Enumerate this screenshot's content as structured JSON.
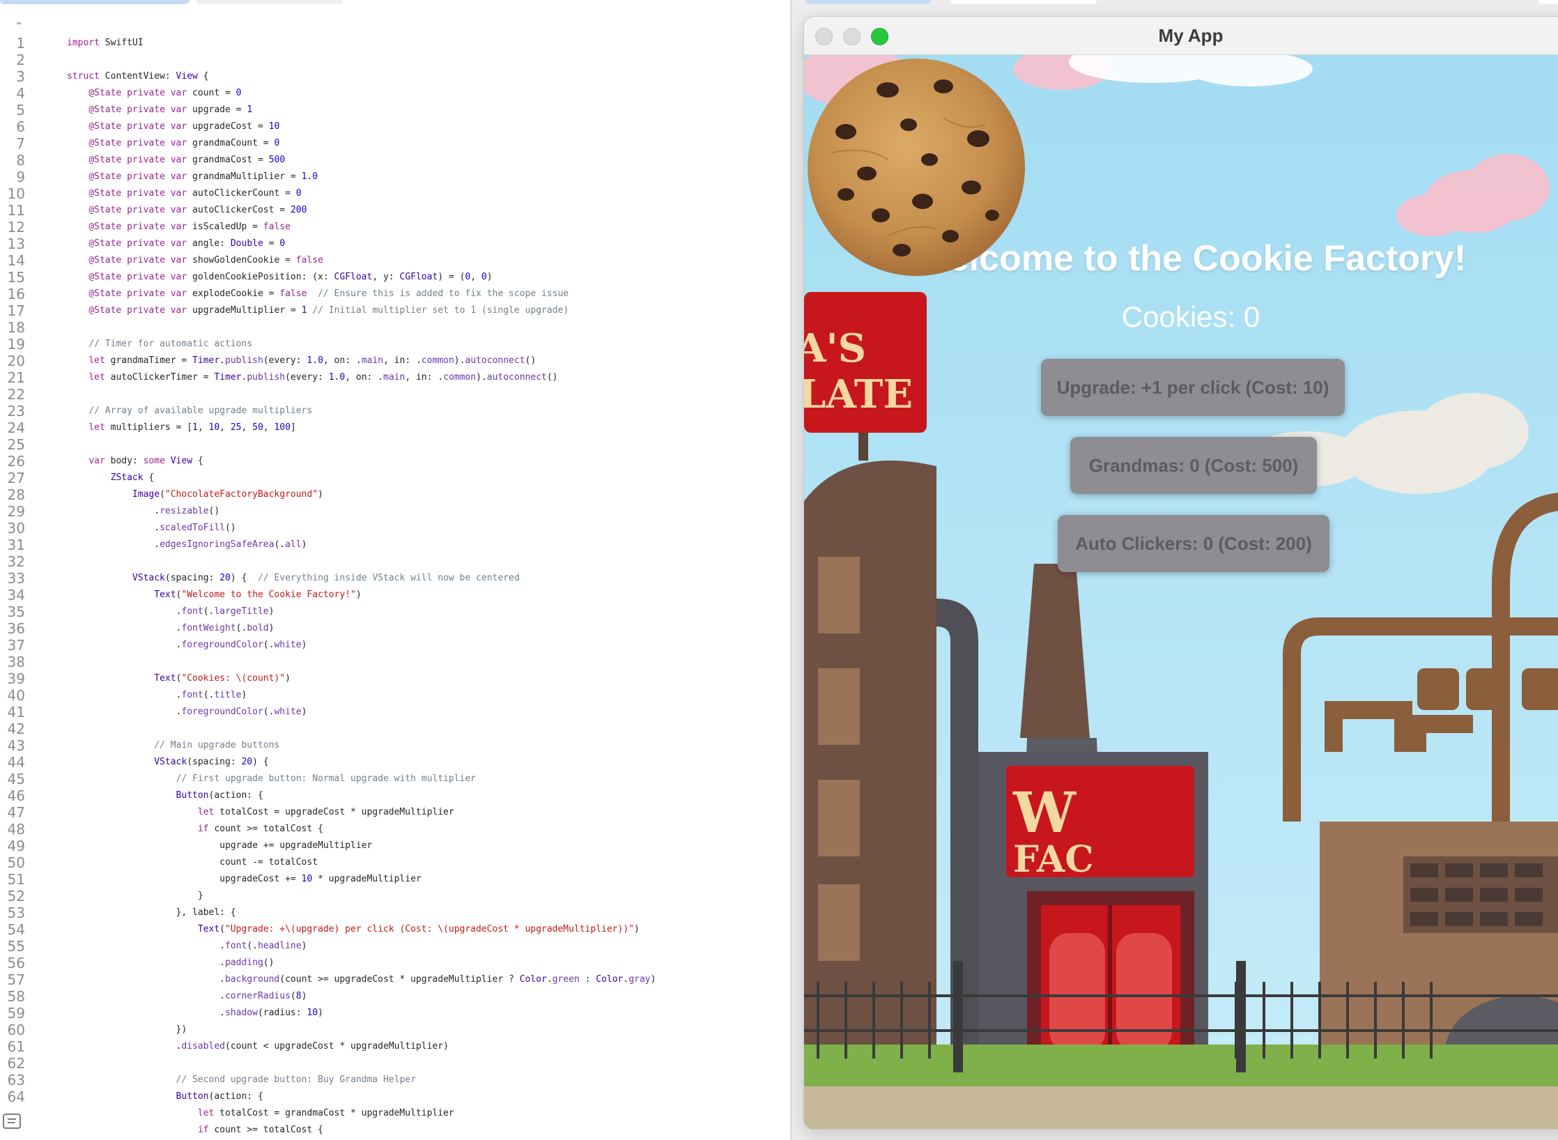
{
  "editor": {
    "lines": [
      {
        "n": "1",
        "t": "import SwiftUI"
      },
      {
        "n": "2",
        "t": ""
      },
      {
        "n": "3",
        "t": "struct ContentView: View {"
      },
      {
        "n": "4",
        "t": "    @State private var count = 0"
      },
      {
        "n": "5",
        "t": "    @State private var upgrade = 1"
      },
      {
        "n": "6",
        "t": "    @State private var upgradeCost = 10"
      },
      {
        "n": "7",
        "t": "    @State private var grandmaCount = 0"
      },
      {
        "n": "8",
        "t": "    @State private var grandmaCost = 500"
      },
      {
        "n": "9",
        "t": "    @State private var grandmaMultiplier = 1.0"
      },
      {
        "n": "10",
        "t": "    @State private var autoClickerCount = 0"
      },
      {
        "n": "11",
        "t": "    @State private var autoClickerCost = 200"
      },
      {
        "n": "12",
        "t": "    @State private var isScaledUp = false"
      },
      {
        "n": "13",
        "t": "    @State private var angle: Double = 0"
      },
      {
        "n": "14",
        "t": "    @State private var showGoldenCookie = false"
      },
      {
        "n": "15",
        "t": "    @State private var goldenCookiePosition: (x: CGFloat, y: CGFloat) = (0, 0)"
      },
      {
        "n": "16",
        "t": "    @State private var explodeCookie = false  // Ensure this is added to fix the scope issue"
      },
      {
        "n": "17",
        "t": "    @State private var upgradeMultiplier = 1 // Initial multiplier set to 1 (single upgrade)"
      },
      {
        "n": "18",
        "t": ""
      },
      {
        "n": "19",
        "t": "    // Timer for automatic actions"
      },
      {
        "n": "20",
        "t": "    let grandmaTimer = Timer.publish(every: 1.0, on: .main, in: .common).autoconnect()"
      },
      {
        "n": "21",
        "t": "    let autoClickerTimer = Timer.publish(every: 1.0, on: .main, in: .common).autoconnect()"
      },
      {
        "n": "22",
        "t": ""
      },
      {
        "n": "23",
        "t": "    // Array of available upgrade multipliers"
      },
      {
        "n": "24",
        "t": "    let multipliers = [1, 10, 25, 50, 100]"
      },
      {
        "n": "25",
        "t": ""
      },
      {
        "n": "26",
        "t": "    var body: some View {"
      },
      {
        "n": "27",
        "t": "        ZStack {"
      },
      {
        "n": "28",
        "t": "            Image(\"ChocolateFactoryBackground\")"
      },
      {
        "n": "29",
        "t": "                .resizable()"
      },
      {
        "n": "30",
        "t": "                .scaledToFill()"
      },
      {
        "n": "31",
        "t": "                .edgesIgnoringSafeArea(.all)"
      },
      {
        "n": "32",
        "t": ""
      },
      {
        "n": "33",
        "t": "            VStack(spacing: 20) {  // Everything inside VStack will now be centered"
      },
      {
        "n": "34",
        "t": "                Text(\"Welcome to the Cookie Factory!\")"
      },
      {
        "n": "35",
        "t": "                    .font(.largeTitle)"
      },
      {
        "n": "36",
        "t": "                    .fontWeight(.bold)"
      },
      {
        "n": "37",
        "t": "                    .foregroundColor(.white)"
      },
      {
        "n": "38",
        "t": ""
      },
      {
        "n": "39",
        "t": "                Text(\"Cookies: \\(count)\")"
      },
      {
        "n": "40",
        "t": "                    .font(.title)"
      },
      {
        "n": "41",
        "t": "                    .foregroundColor(.white)"
      },
      {
        "n": "42",
        "t": ""
      },
      {
        "n": "43",
        "t": "                // Main upgrade buttons"
      },
      {
        "n": "44",
        "t": "                VStack(spacing: 20) {"
      },
      {
        "n": "45",
        "t": "                    // First upgrade button: Normal upgrade with multiplier"
      },
      {
        "n": "46",
        "t": "                    Button(action: {"
      },
      {
        "n": "47",
        "t": "                        let totalCost = upgradeCost * upgradeMultiplier"
      },
      {
        "n": "48",
        "t": "                        if count >= totalCost {"
      },
      {
        "n": "49",
        "t": "                            upgrade += upgradeMultiplier"
      },
      {
        "n": "50",
        "t": "                            count -= totalCost"
      },
      {
        "n": "51",
        "t": "                            upgradeCost += 10 * upgradeMultiplier"
      },
      {
        "n": "52",
        "t": "                        }"
      },
      {
        "n": "53",
        "t": "                    }, label: {"
      },
      {
        "n": "54",
        "t": "                        Text(\"Upgrade: +\\(upgrade) per click (Cost: \\(upgradeCost * upgradeMultiplier))\")"
      },
      {
        "n": "55",
        "t": "                            .font(.headline)"
      },
      {
        "n": "56",
        "t": "                            .padding()"
      },
      {
        "n": "57",
        "t": "                            .background(count >= upgradeCost * upgradeMultiplier ? Color.green : Color.gray)"
      },
      {
        "n": "58",
        "t": "                            .cornerRadius(8)"
      },
      {
        "n": "59",
        "t": "                            .shadow(radius: 10)"
      },
      {
        "n": "60",
        "t": "                    })"
      },
      {
        "n": "61",
        "t": "                    .disabled(count < upgradeCost * upgradeMultiplier)"
      },
      {
        "n": "62",
        "t": ""
      },
      {
        "n": "63",
        "t": "                    // Second upgrade button: Buy Grandma Helper"
      },
      {
        "n": "64",
        "t": "                    Button(action: {"
      },
      {
        "n": "",
        "t": "                        let totalCost = grandmaCost * upgradeMultiplier"
      },
      {
        "n": "",
        "t": "                        if count >= totalCost {"
      }
    ]
  },
  "app": {
    "window_title": "My App",
    "headline": "Welcome to the Cookie Factory!",
    "cookies_label": "Cookies: 0",
    "buttons": {
      "upgrade": "Upgrade: +1 per click (Cost: 10)",
      "grandmas": "Grandmas: 0 (Cost: 500)",
      "auto_clickers": "Auto Clickers: 0 (Cost: 200)"
    },
    "sign_top": [
      "A'S",
      "LATE"
    ],
    "sign_bottom": [
      "W",
      "FAC"
    ]
  },
  "colors": {
    "sky": "#a9def3",
    "button_gray": "#8d8d92",
    "traffic_close": "#dcdcdc",
    "traffic_zoom": "#27c840",
    "factory_red": "#c8161d"
  },
  "icons": {
    "bottom_bar": "document-outline-icon",
    "cookie": "cookie-icon"
  }
}
